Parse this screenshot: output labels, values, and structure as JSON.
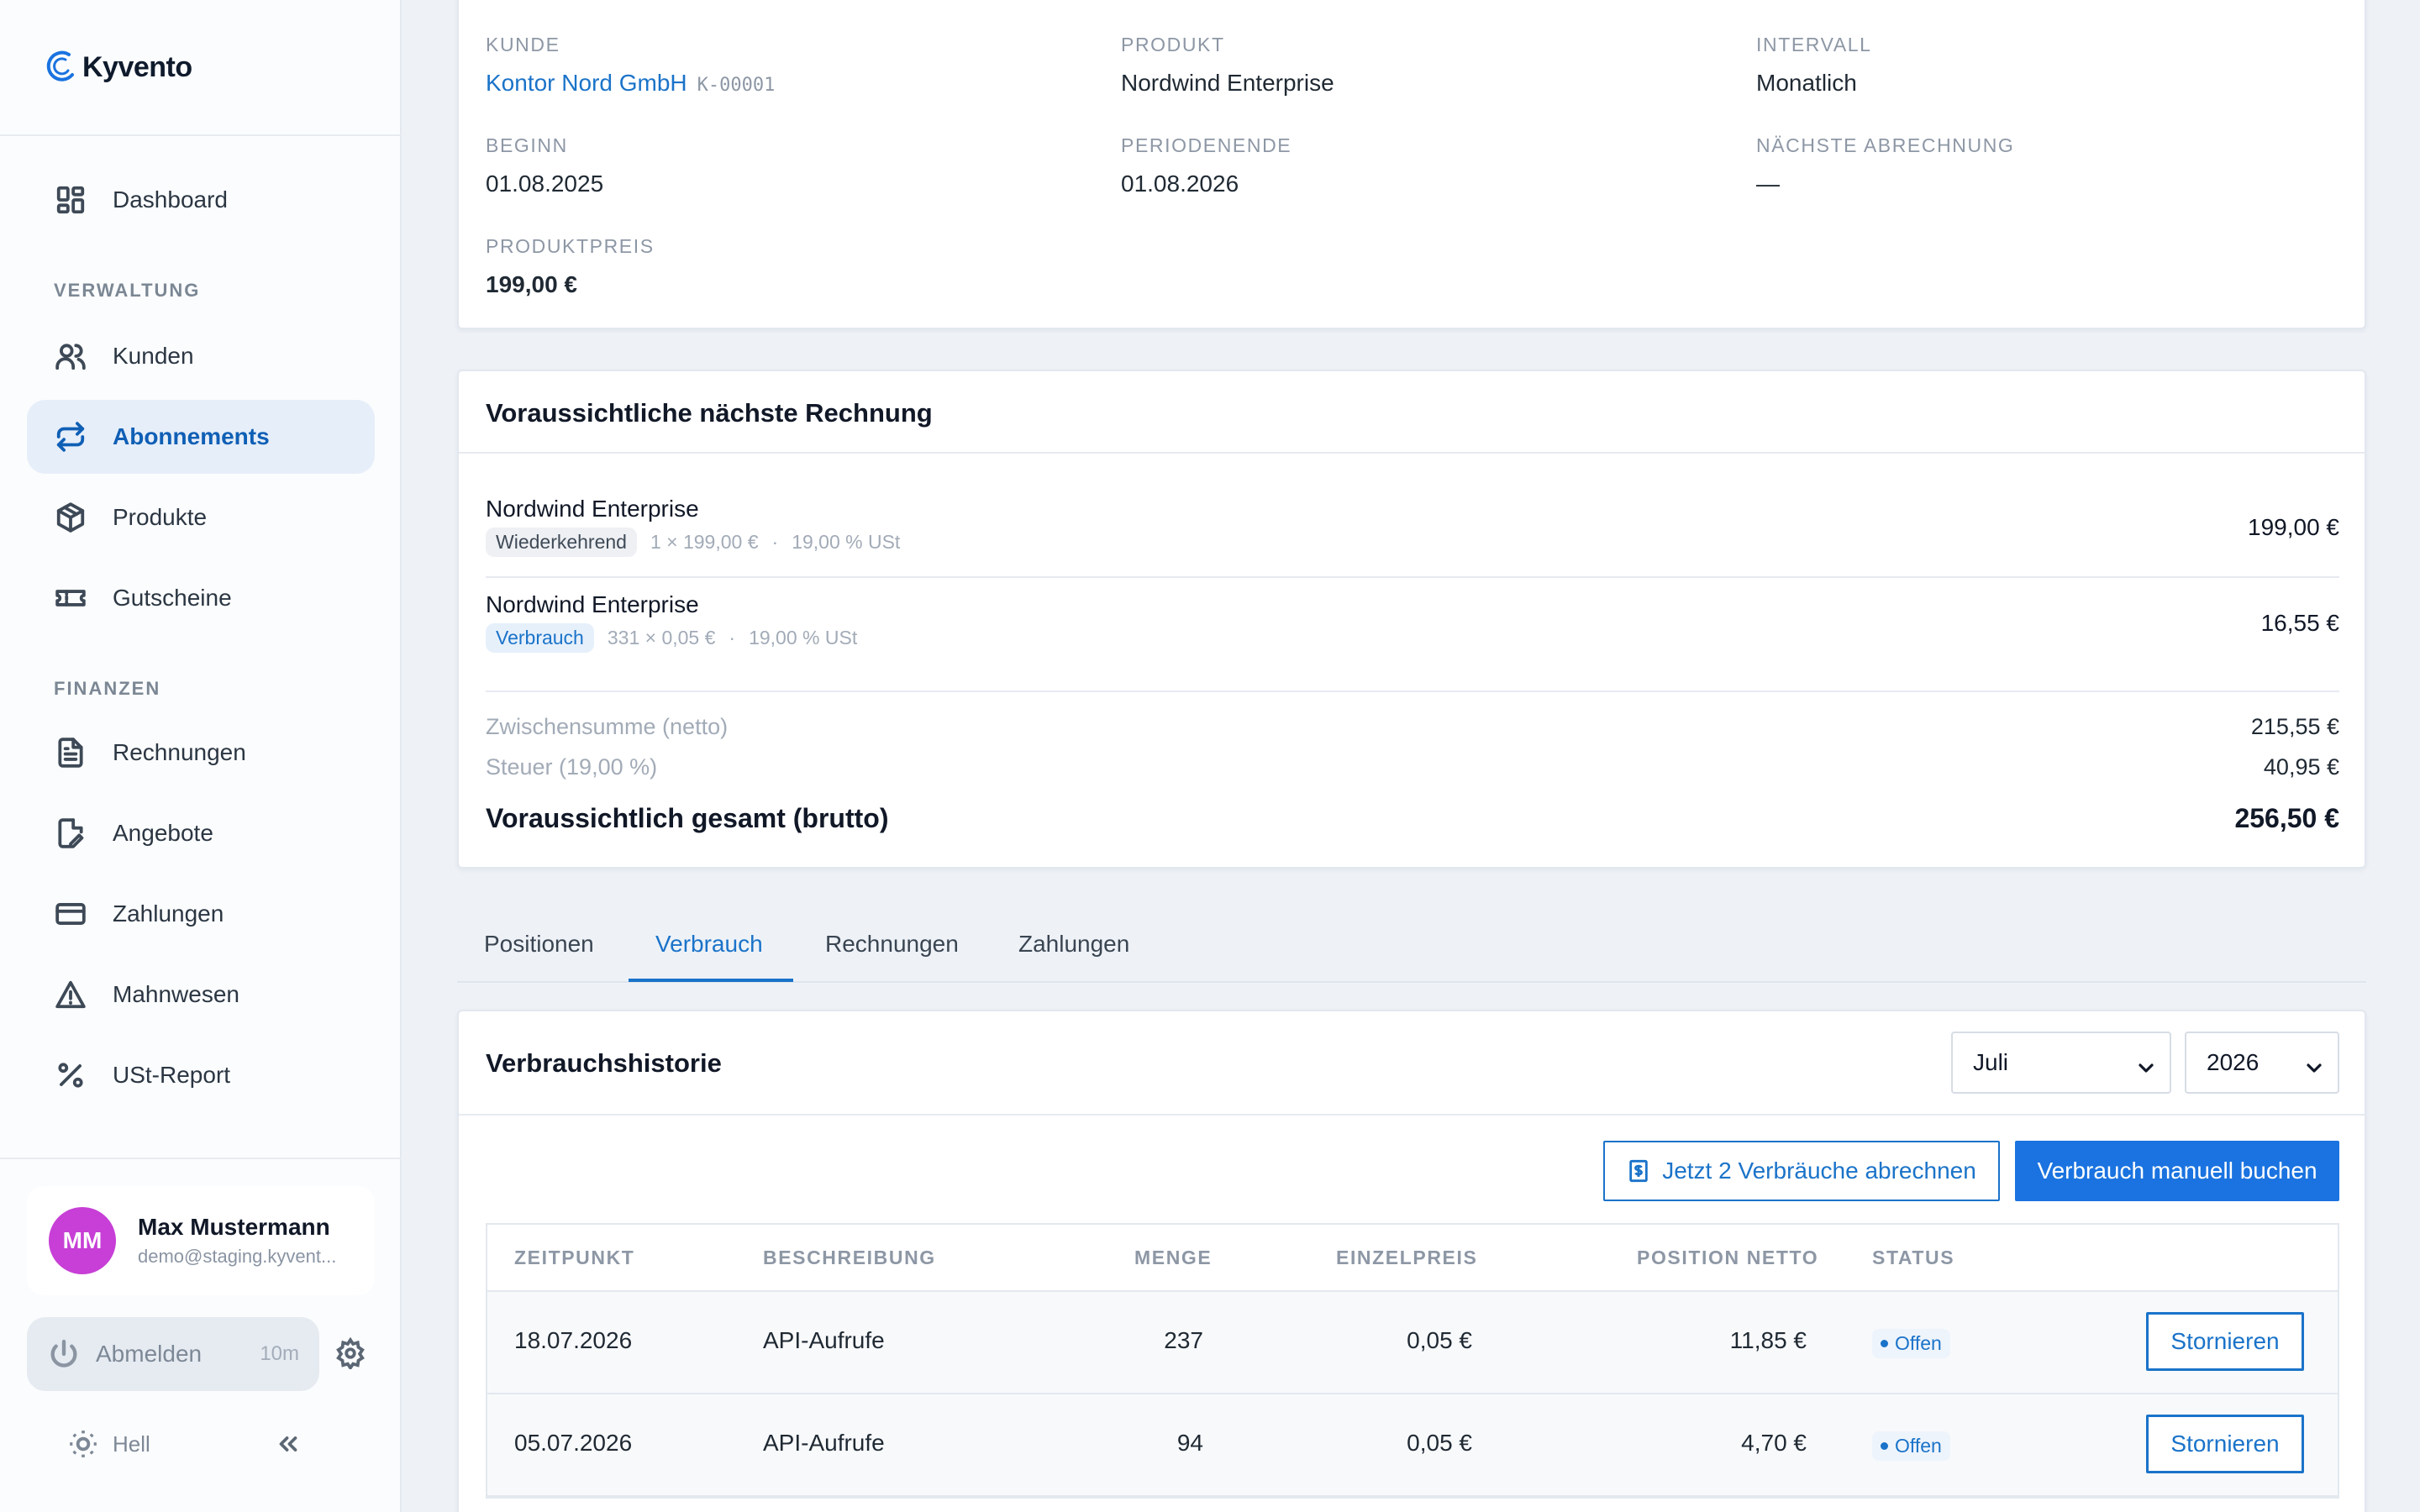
{
  "app": {
    "name": "Kyvento"
  },
  "sidebar": {
    "dashboard": "Dashboard",
    "sections": {
      "verwaltung": "VERWALTUNG",
      "finanzen": "FINANZEN"
    },
    "items": [
      {
        "label": "Kunden",
        "icon": "users-icon"
      },
      {
        "label": "Abonnements",
        "icon": "repeat-icon",
        "active": true
      },
      {
        "label": "Produkte",
        "icon": "box-icon"
      },
      {
        "label": "Gutscheine",
        "icon": "ticket-icon"
      },
      {
        "label": "Rechnungen",
        "icon": "document-icon"
      },
      {
        "label": "Angebote",
        "icon": "edit-document-icon"
      },
      {
        "label": "Zahlungen",
        "icon": "credit-card-icon"
      },
      {
        "label": "Mahnwesen",
        "icon": "warning-icon"
      },
      {
        "label": "USt-Report",
        "icon": "percent-icon"
      }
    ],
    "user": {
      "initials": "MM",
      "name": "Max Mustermann",
      "email": "demo@staging.kyvent..."
    },
    "logout": {
      "label": "Abmelden",
      "timer": "10m"
    },
    "theme": "Hell"
  },
  "subscription": {
    "labels": {
      "kunde": "KUNDE",
      "produkt": "PRODUKT",
      "intervall": "INTERVALL",
      "beginn": "BEGINN",
      "periodenende": "PERIODENENDE",
      "naechste": "NÄCHSTE ABRECHNUNG",
      "preis": "PRODUKTPREIS"
    },
    "values": {
      "kunde": "Kontor Nord GmbH",
      "kunde_code": "K-00001",
      "produkt": "Nordwind Enterprise",
      "intervall": "Monatlich",
      "beginn": "01.08.2025",
      "periodenende": "01.08.2026",
      "naechste": "—",
      "preis": "199,00 €"
    }
  },
  "forecast": {
    "title": "Voraussichtliche nächste Rechnung",
    "items": [
      {
        "title": "Nordwind Enterprise",
        "badge": "Wiederkehrend",
        "qty": "1 × 199,00 €",
        "tax": "19,00 % USt",
        "amount": "199,00 €"
      },
      {
        "title": "Nordwind Enterprise",
        "badge": "Verbrauch",
        "qty": "331 × 0,05 €",
        "tax": "19,00 % USt",
        "amount": "16,55 €"
      }
    ],
    "separator": "·",
    "subtotal": {
      "label": "Zwischensumme (netto)",
      "value": "215,55 €"
    },
    "tax": {
      "label": "Steuer (19,00 %)",
      "value": "40,95 €"
    },
    "total": {
      "label": "Voraussichtlich gesamt (brutto)",
      "value": "256,50 €"
    }
  },
  "tabs": [
    {
      "label": "Positionen"
    },
    {
      "label": "Verbrauch",
      "active": true
    },
    {
      "label": "Rechnungen"
    },
    {
      "label": "Zahlungen"
    }
  ],
  "usage": {
    "title": "Verbrauchshistorie",
    "month": "Juli",
    "year": "2026",
    "bill_button": "Jetzt 2 Verbräuche abrechnen",
    "book_button": "Verbrauch manuell buchen",
    "columns": [
      "ZEITPUNKT",
      "BESCHREIBUNG",
      "MENGE",
      "EINZELPREIS",
      "POSITION NETTO",
      "STATUS"
    ],
    "rows": [
      {
        "date": "18.07.2026",
        "desc": "API-Aufrufe",
        "qty": "237",
        "unit": "0,05 €",
        "net": "11,85 €",
        "status": "Offen",
        "action": "Stornieren"
      },
      {
        "date": "05.07.2026",
        "desc": "API-Aufrufe",
        "qty": "94",
        "unit": "0,05 €",
        "net": "4,70 €",
        "status": "Offen",
        "action": "Stornieren"
      }
    ]
  }
}
